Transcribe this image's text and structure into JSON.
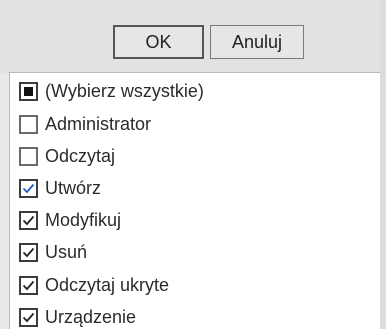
{
  "buttons": {
    "ok_label": "OK",
    "cancel_label": "Anuluj"
  },
  "items": [
    {
      "label": "(Wybierz wszystkie)",
      "state": "indeterminate"
    },
    {
      "label": "Administrator",
      "state": "unchecked"
    },
    {
      "label": "Odczytaj",
      "state": "unchecked"
    },
    {
      "label": "Utwórz",
      "state": "checked"
    },
    {
      "label": "Modyfikuj",
      "state": "checked"
    },
    {
      "label": "Usuń",
      "state": "checked"
    },
    {
      "label": "Odczytaj ukryte",
      "state": "checked"
    },
    {
      "label": "Urządzenie",
      "state": "checked"
    }
  ],
  "colors": {
    "check_blue": "#1f5fc4",
    "check_dark": "#222222"
  }
}
